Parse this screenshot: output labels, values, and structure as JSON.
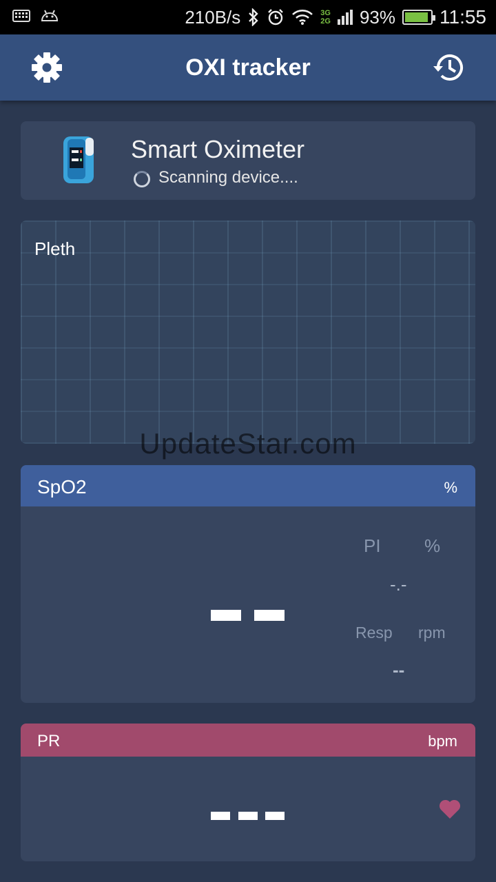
{
  "status_bar": {
    "left_icons": [
      "keyboard-icon",
      "android-icon"
    ],
    "network_speed": "210B/s",
    "net_type_top": "3G",
    "net_type_bottom": "2G",
    "battery": "93%",
    "battery_level": 0.93,
    "time": "11:55",
    "right_icons": [
      "bluetooth-icon",
      "alarm-icon",
      "wifi-icon",
      "signal-icon",
      "battery-icon"
    ]
  },
  "app_bar": {
    "title": "OXI tracker",
    "left_icon": "settings-gear-icon",
    "right_icon": "history-icon"
  },
  "device": {
    "name": "Smart Oximeter",
    "status": "Scanning device...."
  },
  "pleth": {
    "label": "Pleth"
  },
  "watermark": "UpdateStar.com",
  "spo2": {
    "title": "SpO2",
    "unit": "%",
    "value": "-- --",
    "pi_label": "PI",
    "pi_unit": "%",
    "pi_value": "-.-",
    "resp_label": "Resp",
    "resp_unit": "rpm",
    "resp_value": "--"
  },
  "pr": {
    "title": "PR",
    "unit": "bpm",
    "value": "- - -",
    "icon": "heart-icon"
  },
  "colors": {
    "background": "#2b3850",
    "app_bar": "#34507e",
    "card": "#37455f",
    "spo2_header": "#3f5f9c",
    "pr_header": "#a14a6c",
    "heart": "#b04f77"
  }
}
